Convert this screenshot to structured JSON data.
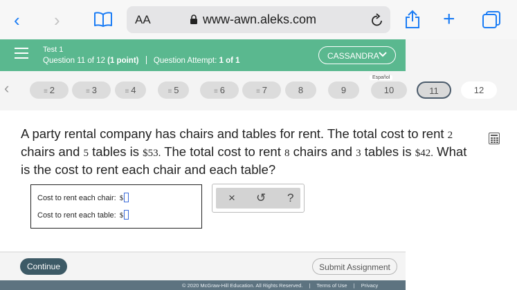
{
  "browser": {
    "url": "www-awn.aleks.com",
    "text_size_label": "AA"
  },
  "header": {
    "test_title": "Test 1",
    "question_label": "Question 11 of 12",
    "question_points": "(1 point)",
    "attempt_label": "Question Attempt:",
    "attempt_value": "1 of 1",
    "user_name": "CASSANDRA"
  },
  "question_nav": {
    "items": [
      {
        "label": "2",
        "answered": true
      },
      {
        "label": "3",
        "answered": true
      },
      {
        "label": "4",
        "answered": true
      },
      {
        "label": "5",
        "answered": true
      },
      {
        "label": "6",
        "answered": true
      },
      {
        "label": "7",
        "answered": true
      },
      {
        "label": "8",
        "answered": false
      },
      {
        "label": "9",
        "answered": false
      },
      {
        "label": "10",
        "answered": false
      },
      {
        "label": "11",
        "answered": false,
        "current": true
      },
      {
        "label": "12",
        "answered": false
      }
    ],
    "espanol_label": "Español"
  },
  "question": {
    "t1": "A party rental company has chairs and tables for rent. The total cost to rent ",
    "n1": "2",
    "t2": " chairs and ",
    "n2": "5",
    "t3": " tables is ",
    "n3": "$53.",
    "t4": " The total cost to rent ",
    "n4": "8",
    "t5": " chairs and ",
    "n5": "3",
    "t6": " tables is ",
    "n6": "$42.",
    "t7": " What is the cost to rent each chair and each table?"
  },
  "answer": {
    "chair_label": "Cost to rent each chair:",
    "table_label": "Cost to rent each table:",
    "currency": "$",
    "chair_value": "",
    "table_value": ""
  },
  "tools": {
    "clear": "×",
    "undo": "↺",
    "help": "?"
  },
  "footer": {
    "continue_label": "Continue",
    "submit_label": "Submit Assignment",
    "copyright": "© 2020 McGraw-Hill Education. All Rights Reserved.",
    "terms": "Terms of Use",
    "separator": "|",
    "privacy": "Privacy"
  },
  "colors": {
    "header_green": "#5ab88f",
    "continue_bg": "#3d5a66",
    "safari_blue": "#1a7cf5"
  }
}
